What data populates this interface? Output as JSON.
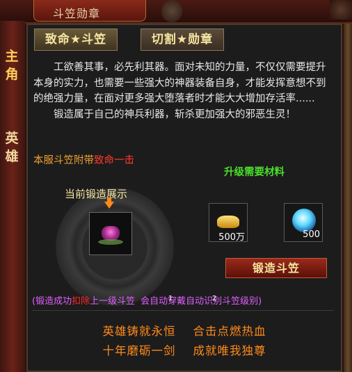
{
  "window": {
    "title": "斗笠勋章"
  },
  "side_tabs": [
    {
      "label_1": "主",
      "label_2": "角"
    },
    {
      "label_1": "英",
      "label_2": "雄"
    }
  ],
  "tabs": [
    {
      "label": "致命★斗笠"
    },
    {
      "label": "切割★勋章"
    }
  ],
  "description": {
    "para1": "工欲善其事，必先利其器。面对未知的力量，不仅仅需要提升本身的实力，也需要一些强大的神器装备自身，才能发挥意想不到的绝强力量，在面对更多强大堕落者时才能大大增加存活率......",
    "para2": "锻造属于自己的神兵利器，斩杀更加强大的邪恶生灵！"
  },
  "server_effect": {
    "prefix": "本服斗笠附带",
    "effect": "致命一击"
  },
  "forge_display": {
    "label": "当前锻造展示"
  },
  "materials": {
    "title": "升级需要材料",
    "items": [
      {
        "icon": "gold-ingot-icon",
        "count": "500万"
      },
      {
        "icon": "crystal-orb-icon",
        "count": "500"
      }
    ]
  },
  "forge_button": {
    "label": "锻造斗笠"
  },
  "note": {
    "part1": "(锻造成功",
    "part2": "扣除",
    "part3": "上一级斗笠",
    "part4": "会自动穿戴自动识别斗笠级别)",
    "badge1": "1",
    "badge2": "2"
  },
  "slogans": {
    "line1": "英雄铸就永恒    合击点燃热血",
    "line2": "十年磨砺一剑    成就唯我独尊"
  }
}
